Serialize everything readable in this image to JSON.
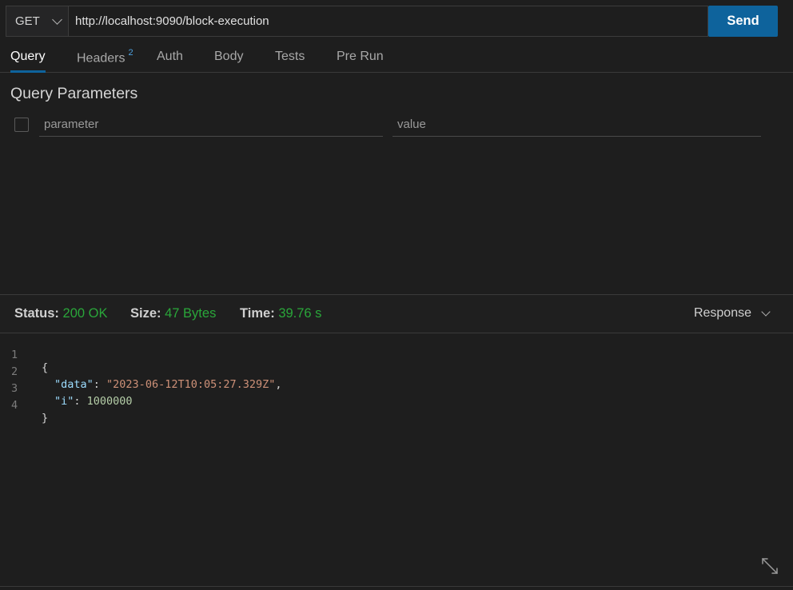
{
  "request": {
    "method": "GET",
    "url": "http://localhost:9090/block-execution",
    "send_label": "Send"
  },
  "tabs": [
    {
      "label": "Query",
      "active": true
    },
    {
      "label": "Headers",
      "badge": "2"
    },
    {
      "label": "Auth"
    },
    {
      "label": "Body"
    },
    {
      "label": "Tests"
    },
    {
      "label": "Pre Run"
    }
  ],
  "query": {
    "title": "Query Parameters",
    "key_placeholder": "parameter",
    "value_placeholder": "value"
  },
  "response": {
    "status_label": "Status:",
    "status_value": "200 OK",
    "size_label": "Size:",
    "size_value": "47 Bytes",
    "time_label": "Time:",
    "time_value": "39.76 s",
    "view_label": "Response",
    "lines": [
      {
        "num": "1",
        "open": "{"
      },
      {
        "num": "2",
        "key": "\"data\"",
        "sep": ": ",
        "str": "\"2023-06-12T10:05:27.329Z\"",
        "end": ","
      },
      {
        "num": "3",
        "key": "\"i\"",
        "sep": ": ",
        "num_val": "1000000"
      },
      {
        "num": "4",
        "close": "}"
      }
    ]
  },
  "colors": {
    "accent": "#0e639c",
    "status_ok": "#2aa63a",
    "background": "#1e1e1e"
  },
  "icons": {
    "method_dropdown": "chevron-down-icon",
    "response_dropdown": "chevron-down-icon",
    "expand": "expand-icon"
  }
}
